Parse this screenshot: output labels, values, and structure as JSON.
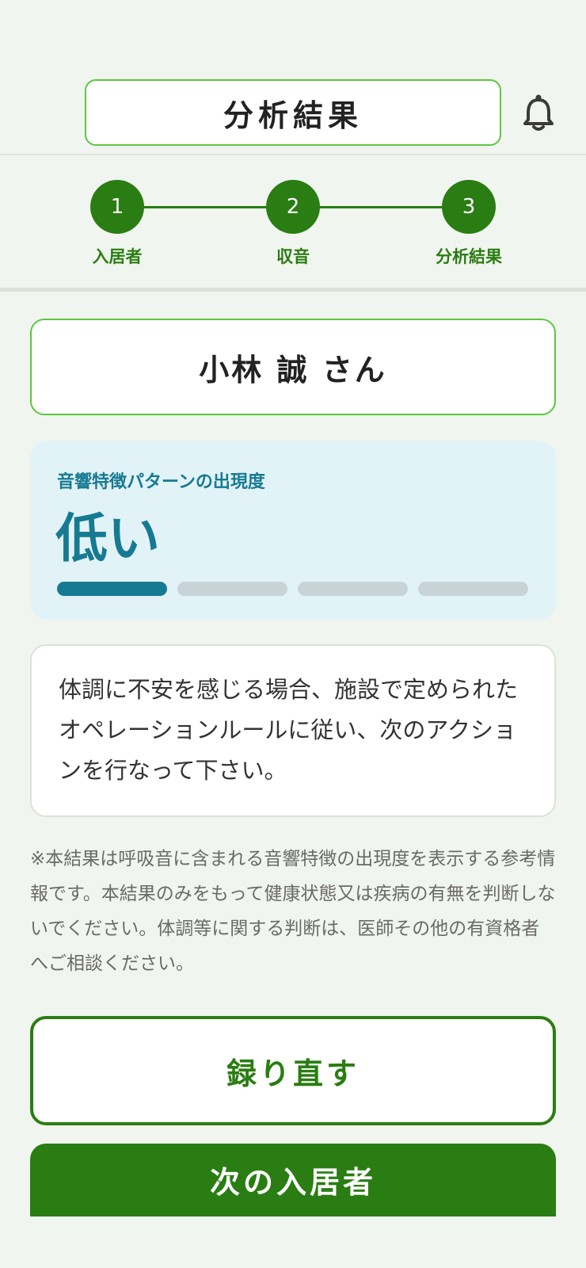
{
  "header": {
    "title": "分析結果"
  },
  "stepper": {
    "steps": [
      {
        "number": "1",
        "label": "入居者"
      },
      {
        "number": "2",
        "label": "収音"
      },
      {
        "number": "3",
        "label": "分析結果"
      }
    ]
  },
  "resident": {
    "name": "小林 誠 さん"
  },
  "result": {
    "label": "音響特徴パターンの出現度",
    "value": "低い",
    "level": 1,
    "level_max": 4,
    "accent_color": "#177a93"
  },
  "message": "体調に不安を感じる場合、施設で定められたオペレーションルールに従い、次のアクションを行なって下さい。",
  "disclaimer": "※本結果は呼吸音に含まれる音響特徴の出現度を表示する参考情報です。本結果のみをもって健康状態又は疾病の有無を判断しないでください。体調等に関する判断は、医師その他の有資格者へご相談ください。",
  "actions": {
    "retry_label": "録り直す",
    "next_label": "次の入居者"
  },
  "colors": {
    "brand_green": "#2a7d12",
    "border_green": "#5cc641"
  },
  "icons": {
    "notification": "bell-icon"
  }
}
